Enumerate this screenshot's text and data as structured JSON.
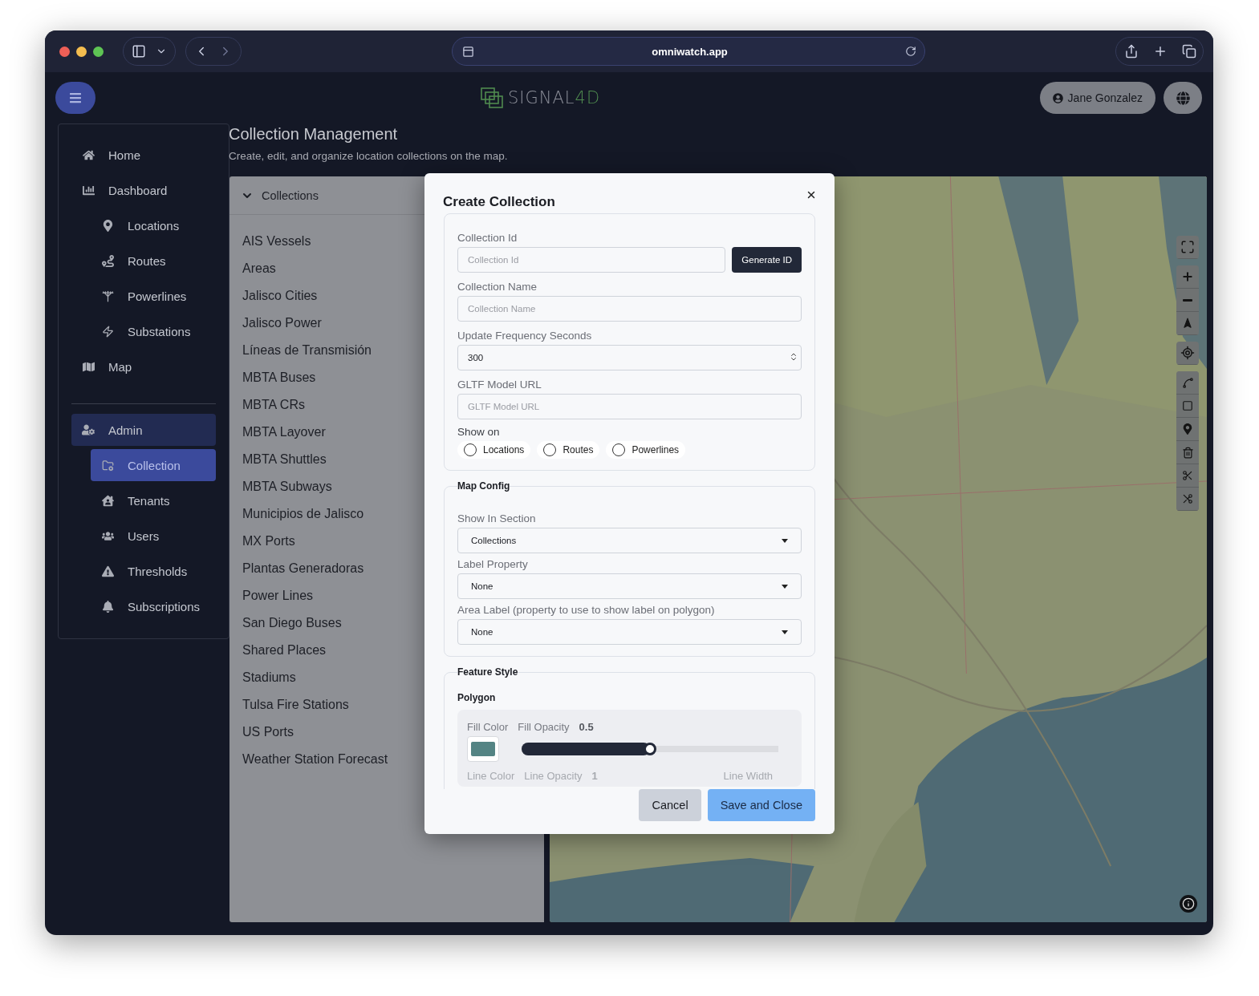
{
  "browser": {
    "url": "omniwatch.app"
  },
  "header": {
    "logo": {
      "text": "SIGNAL",
      "accent": "4D"
    },
    "user": "Jane Gonzalez"
  },
  "sidebar": {
    "items": [
      {
        "label": "Home",
        "selected": false
      },
      {
        "label": "Dashboard",
        "selected": false,
        "children": [
          {
            "label": "Locations",
            "selected": false
          },
          {
            "label": "Routes",
            "selected": false
          },
          {
            "label": "Powerlines",
            "selected": false
          },
          {
            "label": "Substations",
            "selected": false
          }
        ]
      },
      {
        "label": "Map",
        "selected": false
      }
    ],
    "admin": {
      "label": "Admin",
      "active": true,
      "children": [
        {
          "label": "Collection",
          "selected": true
        },
        {
          "label": "Tenants",
          "selected": false
        },
        {
          "label": "Users",
          "selected": false
        },
        {
          "label": "Thresholds",
          "selected": false
        },
        {
          "label": "Subscriptions",
          "selected": false
        }
      ]
    }
  },
  "page": {
    "title": "Collection Management",
    "subtitle": "Create, edit, and organize location collections on the map."
  },
  "collections": {
    "title": "Collections",
    "expanded": true,
    "items": [
      {
        "label": "AIS Vessels",
        "selected": false
      },
      {
        "label": "Areas",
        "selected": false
      },
      {
        "label": "Jalisco Cities",
        "selected": false
      },
      {
        "label": "Jalisco Power",
        "selected": false
      },
      {
        "label": "Líneas de Transmisión",
        "selected": false
      },
      {
        "label": "MBTA Buses",
        "selected": false
      },
      {
        "label": "MBTA CRs",
        "selected": false
      },
      {
        "label": "MBTA Layover",
        "selected": false
      },
      {
        "label": "MBTA Shuttles",
        "selected": false
      },
      {
        "label": "MBTA Subways",
        "selected": false
      },
      {
        "label": "Municipios de Jalisco",
        "selected": false
      },
      {
        "label": "MX Ports",
        "selected": false
      },
      {
        "label": "Plantas Generadoras",
        "selected": false
      },
      {
        "label": "Power Lines",
        "selected": false
      },
      {
        "label": "San Diego Buses",
        "selected": false
      },
      {
        "label": "Shared Places",
        "selected": false
      },
      {
        "label": "Stadiums",
        "selected": false
      },
      {
        "label": "Tulsa Fire Stations",
        "selected": false
      },
      {
        "label": "US Ports",
        "selected": false
      },
      {
        "label": "Weather Station Forecast",
        "selected": false
      }
    ]
  },
  "modal": {
    "title": "Create Collection",
    "fields": [
      {
        "kind": "id",
        "label": "Collection Id",
        "placeholder": "Collection Id",
        "button": "Generate ID"
      },
      {
        "kind": "text",
        "label": "Collection Name",
        "placeholder": "Collection Name"
      },
      {
        "kind": "number",
        "label": "Update Frequency Seconds",
        "value": "300"
      },
      {
        "kind": "text",
        "label": "GLTF Model URL",
        "placeholder": "GLTF Model URL"
      }
    ],
    "show_on": {
      "label": "Show on",
      "options": [
        {
          "label": "Locations",
          "selected": false
        },
        {
          "label": "Routes",
          "selected": false
        },
        {
          "label": "Powerlines",
          "selected": false
        }
      ]
    },
    "map_config": {
      "title": "Map Config",
      "selects": [
        {
          "label": "Show In Section",
          "value": "Collections"
        },
        {
          "label": "Label Property",
          "value": "None"
        },
        {
          "label": "Area Label (property to use to show label on polygon)",
          "value": "None"
        }
      ]
    },
    "feature_style": {
      "title": "Feature Style",
      "polygon": {
        "title": "Polygon",
        "fill_color_label": "Fill Color",
        "fill_opacity_label": "Fill Opacity",
        "fill_opacity_value": "0.5",
        "level": 0.5,
        "line_color_label": "Line Color",
        "line_opacity_label": "Line Opacity",
        "line_opacity_value": "1",
        "line_width_label": "Line Width"
      }
    },
    "buttons": {
      "cancel": "Cancel",
      "save": "Save and Close"
    }
  }
}
